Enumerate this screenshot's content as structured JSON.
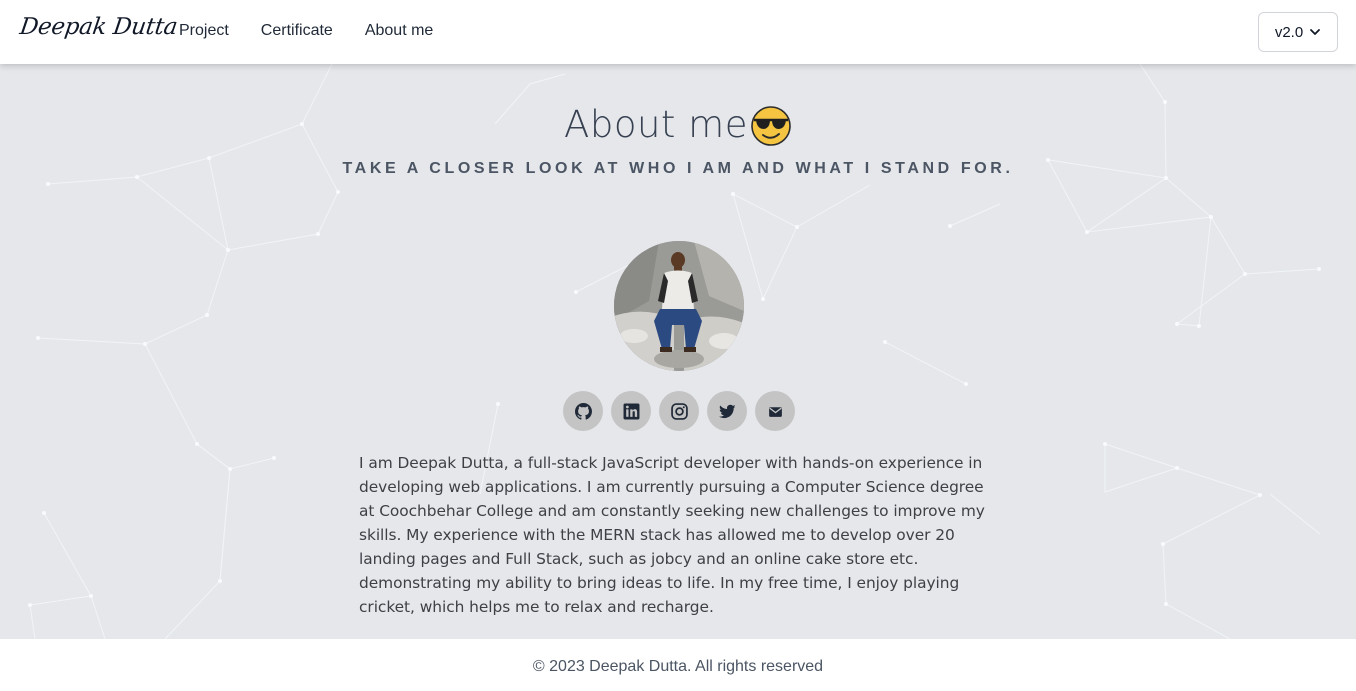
{
  "navbar": {
    "logo": "Deepak Dutta",
    "links": [
      {
        "label": "Project"
      },
      {
        "label": "Certificate"
      },
      {
        "label": "About me"
      }
    ],
    "version": "v2.0"
  },
  "hero": {
    "title": "About me",
    "title_emoji": "smiling-face-with-sunglasses",
    "subtitle": "TAKE A CLOSER LOOK AT WHO I AM AND WHAT I STAND FOR."
  },
  "socials": [
    {
      "icon": "github-icon"
    },
    {
      "icon": "linkedin-icon"
    },
    {
      "icon": "instagram-icon"
    },
    {
      "icon": "twitter-icon"
    },
    {
      "icon": "mail-icon"
    }
  ],
  "bio": "I am Deepak Dutta, a full-stack JavaScript developer with hands-on experience in developing web applications. I am currently pursuing a Computer Science degree at Coochbehar College and am constantly seeking new challenges to improve my skills. My experience with the MERN stack has allowed me to develop over 20 landing pages and Full Stack, such as jobcy and an online cake store etc. demonstrating my ability to bring ideas to life. In my free time, I enjoy playing cricket, which helps me to relax and recharge.",
  "footer": {
    "text": "© 2023 Deepak Dutta. All rights reserved"
  },
  "colors": {
    "page_bg": "#e5e7eb",
    "nav_bg": "#ffffff",
    "social_bg": "#c4c4c4",
    "network_lines": "#f1f5f9"
  }
}
